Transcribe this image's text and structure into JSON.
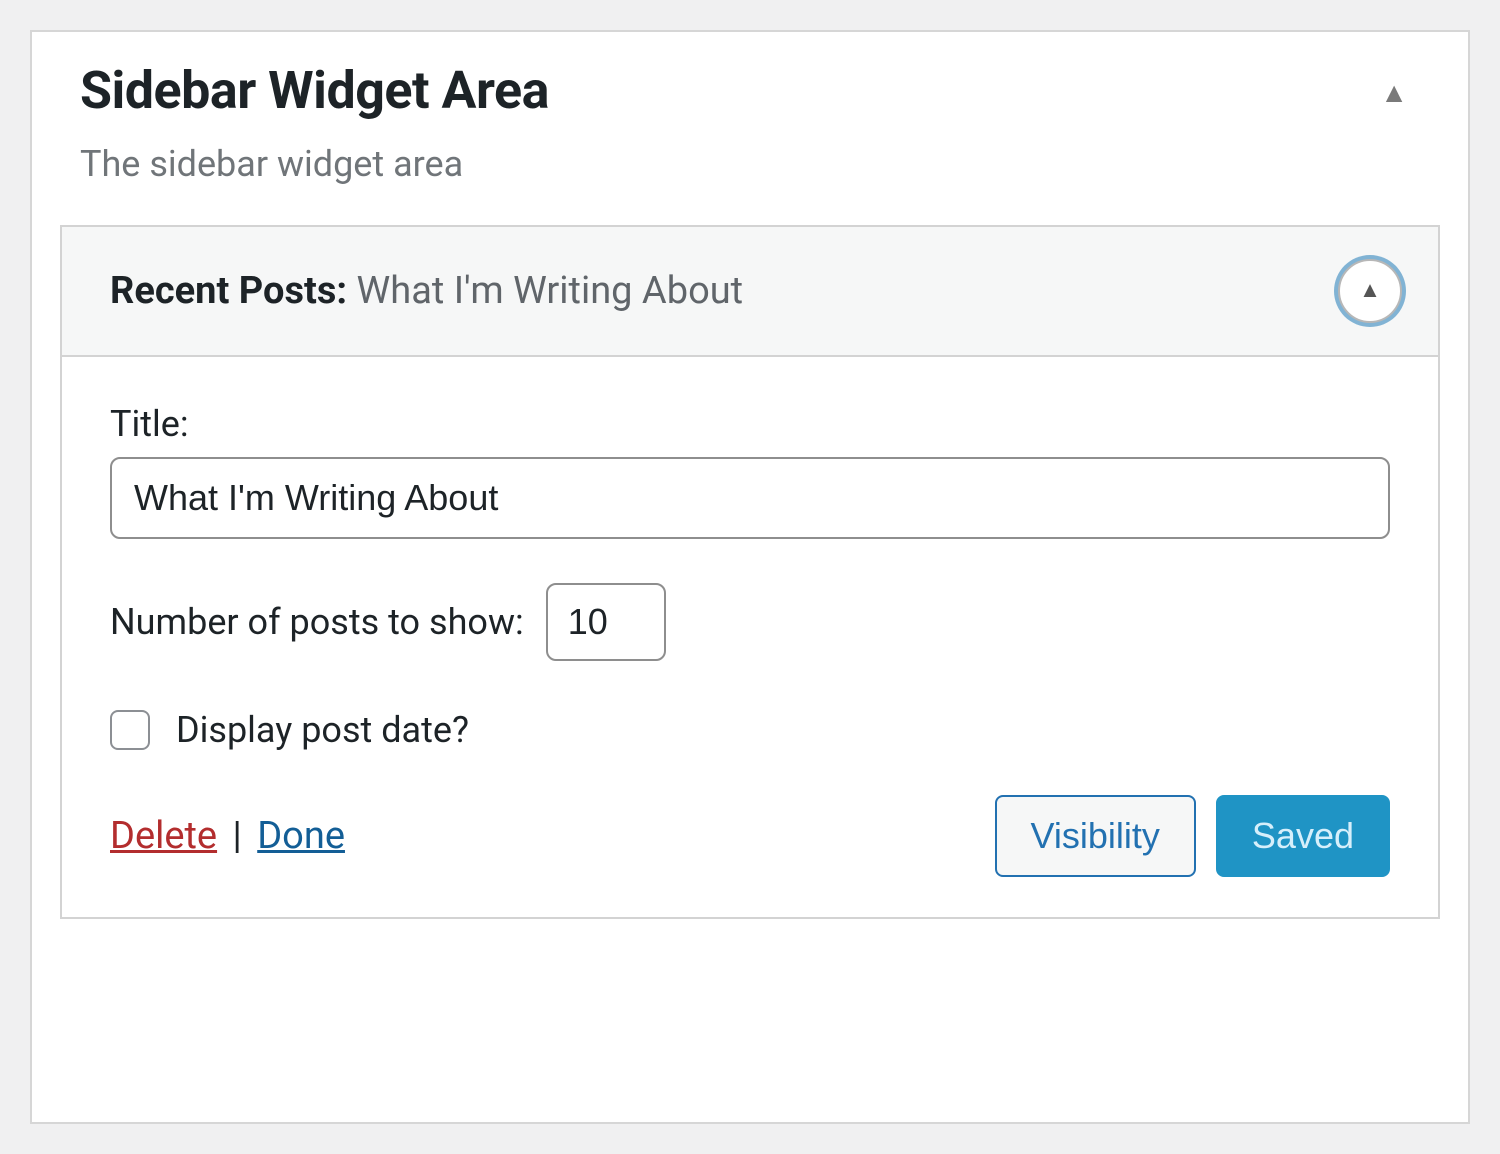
{
  "panel": {
    "title": "Sidebar Widget Area",
    "description": "The sidebar widget area"
  },
  "widget": {
    "type_label": "Recent Posts",
    "instance_label": "What I'm Writing About",
    "fields": {
      "title_label": "Title:",
      "title_value": "What I'm Writing About",
      "num_label": "Number of posts to show:",
      "num_value": "10",
      "display_date_label": "Display post date?",
      "display_date_checked": false
    },
    "actions": {
      "delete": "Delete",
      "separator": "|",
      "done": "Done",
      "visibility": "Visibility",
      "saved": "Saved"
    }
  }
}
